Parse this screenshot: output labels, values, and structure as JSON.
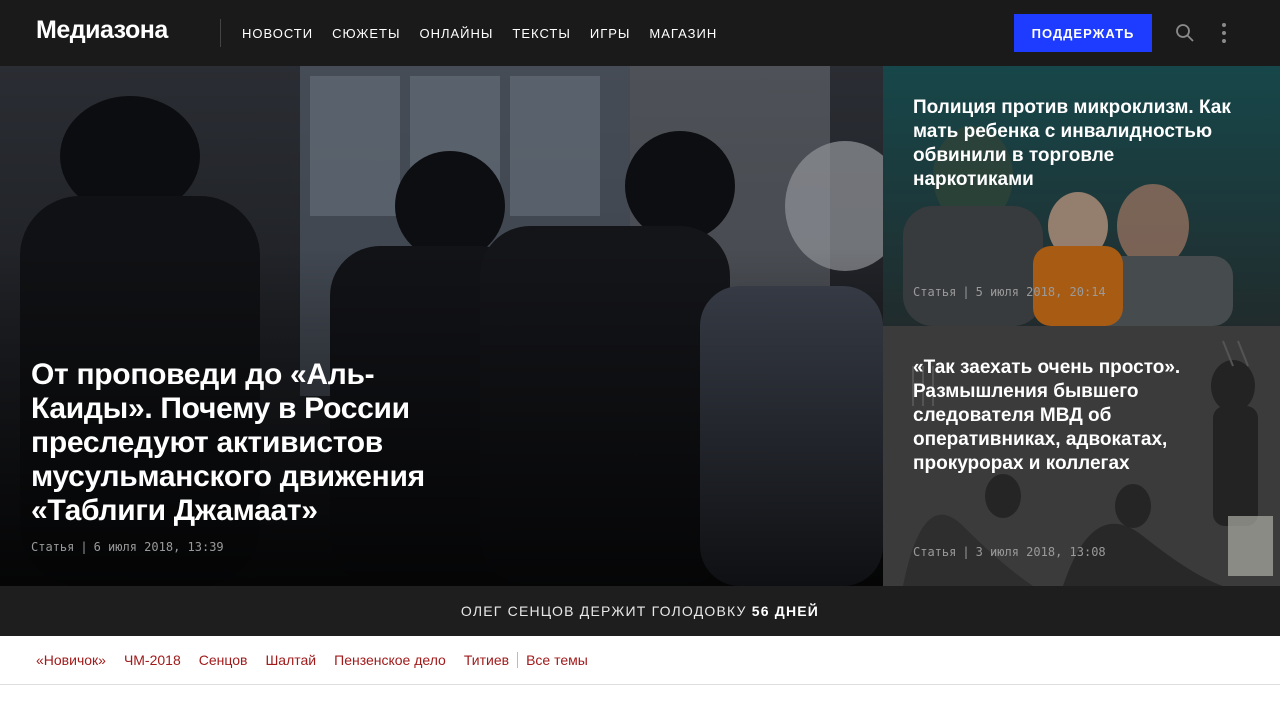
{
  "header": {
    "logo": "Медиазона",
    "nav": [
      "НОВОСТИ",
      "СЮЖЕТЫ",
      "ОНЛАЙНЫ",
      "ТЕКСТЫ",
      "ИГРЫ",
      "МАГАЗИН"
    ],
    "support_label": "ПОДДЕРЖАТЬ",
    "icons": {
      "search": "search-icon",
      "more": "more-vertical-icon"
    }
  },
  "hero": {
    "title": "От проповеди до «Аль-Каиды». Почему в России преследуют активистов мусульманского движения «Таблиги Джамаат»",
    "type": "Статья",
    "date": "6 июля 2018, 13:39"
  },
  "side_articles": [
    {
      "title": "Полиция против микроклизм. Как мать ребенка с инвалидностью обвинили в торговле наркотиками",
      "type": "Статья",
      "date": "5 июля 2018, 20:14"
    },
    {
      "title": "«Так заехать очень просто». Размышления бывшего следователя МВД об оперативниках, адвокатах, прокурорах и коллегах",
      "type": "Статья",
      "date": "3 июля 2018, 13:08"
    }
  ],
  "banner": {
    "text": "ОЛЕГ СЕНЦОВ ДЕРЖИТ ГОЛОДОВКУ",
    "days": "56 ДНЕЙ"
  },
  "topics": [
    "«Новичок»",
    "ЧМ-2018",
    "Сенцов",
    "Шалтай",
    "Пензенское дело",
    "Титиев"
  ],
  "all_topics": "Все темы",
  "colors": {
    "accent": "#1e3cff",
    "topic": "#a11b1b",
    "header_bg": "#1a1a1a"
  }
}
